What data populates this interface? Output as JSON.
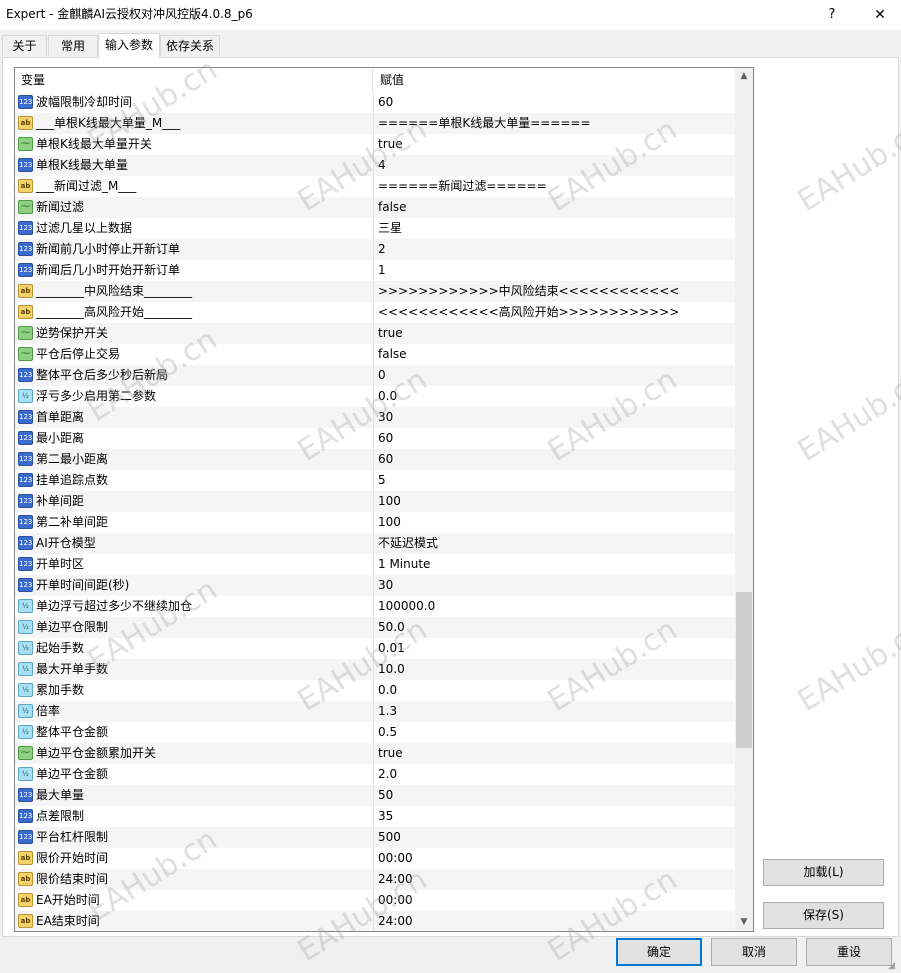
{
  "window": {
    "title": "Expert - 金麒麟AI云授权对冲风控版4.0.8_p6",
    "help_label": "?",
    "close_label": "✕"
  },
  "tabs": [
    {
      "label": "关于",
      "active": false
    },
    {
      "label": "常用",
      "active": false
    },
    {
      "label": "输入参数",
      "active": true
    },
    {
      "label": "依存关系",
      "active": false
    }
  ],
  "grid": {
    "header": {
      "name": "变量",
      "value": "赋值"
    },
    "rows": [
      {
        "type": "int",
        "name": "波幅限制冷却时间",
        "value": "60"
      },
      {
        "type": "str",
        "name": "___单根K线最大单量_M___",
        "value": "======单根K线最大单量======"
      },
      {
        "type": "bool",
        "name": "单根K线最大单量开关",
        "value": "true"
      },
      {
        "type": "int",
        "name": "单根K线最大单量",
        "value": "4"
      },
      {
        "type": "str",
        "name": "___新闻过滤_M___",
        "value": "======新闻过滤======"
      },
      {
        "type": "bool",
        "name": "新闻过滤",
        "value": "false"
      },
      {
        "type": "int",
        "name": "过滤几星以上数据",
        "value": "三星"
      },
      {
        "type": "int",
        "name": "新闻前几小时停止开新订单",
        "value": "2"
      },
      {
        "type": "int",
        "name": "新闻后几小时开始开新订单",
        "value": "1"
      },
      {
        "type": "str",
        "name": "________中风险结束________",
        "value": ">>>>>>>>>>>>中风险结束<<<<<<<<<<<<"
      },
      {
        "type": "str",
        "name": "________高风险开始________",
        "value": "<<<<<<<<<<<<高风险开始>>>>>>>>>>>>"
      },
      {
        "type": "bool",
        "name": "逆势保护开关",
        "value": "true"
      },
      {
        "type": "bool",
        "name": "平仓后停止交易",
        "value": "false"
      },
      {
        "type": "int",
        "name": "整体平仓后多少秒后新局",
        "value": "0"
      },
      {
        "type": "dbl",
        "name": "浮亏多少启用第二参数",
        "value": "0.0"
      },
      {
        "type": "int",
        "name": "首单距离",
        "value": "30"
      },
      {
        "type": "int",
        "name": "最小距离",
        "value": "60"
      },
      {
        "type": "int",
        "name": "第二最小距离",
        "value": "60"
      },
      {
        "type": "int",
        "name": "挂单追踪点数",
        "value": "5"
      },
      {
        "type": "int",
        "name": "补单间距",
        "value": "100"
      },
      {
        "type": "int",
        "name": "第二补单间距",
        "value": "100"
      },
      {
        "type": "int",
        "name": "AI开仓模型",
        "value": "不延迟模式"
      },
      {
        "type": "int",
        "name": "开单时区",
        "value": "1 Minute"
      },
      {
        "type": "int",
        "name": "开单时间间距(秒)",
        "value": "30"
      },
      {
        "type": "dbl",
        "name": "单边浮亏超过多少不继续加仓",
        "value": "100000.0"
      },
      {
        "type": "dbl",
        "name": "单边平仓限制",
        "value": "50.0"
      },
      {
        "type": "dbl",
        "name": "起始手数",
        "value": "0.01"
      },
      {
        "type": "dbl",
        "name": "最大开单手数",
        "value": "10.0"
      },
      {
        "type": "dbl",
        "name": "累加手数",
        "value": "0.0"
      },
      {
        "type": "dbl",
        "name": "倍率",
        "value": "1.3"
      },
      {
        "type": "dbl",
        "name": "整体平仓金额",
        "value": "0.5"
      },
      {
        "type": "bool",
        "name": "单边平仓金额累加开关",
        "value": "true"
      },
      {
        "type": "dbl",
        "name": "单边平仓金额",
        "value": "2.0"
      },
      {
        "type": "int",
        "name": "最大单量",
        "value": "50"
      },
      {
        "type": "int",
        "name": "点差限制",
        "value": "35"
      },
      {
        "type": "int",
        "name": "平台杠杆限制",
        "value": "500"
      },
      {
        "type": "str",
        "name": "限价开始时间",
        "value": "00:00"
      },
      {
        "type": "str",
        "name": "限价结束时间",
        "value": "24:00"
      },
      {
        "type": "str",
        "name": "EA开始时间",
        "value": "00:00"
      },
      {
        "type": "str",
        "name": "EA结束时间",
        "value": "24:00"
      }
    ]
  },
  "type_icons": {
    "int": "123",
    "str": "ab",
    "bool": "⁓",
    "dbl": "½"
  },
  "buttons": {
    "load": "加载(L)",
    "save": "保存(S)",
    "ok": "确定",
    "cancel": "取消",
    "reset": "重设"
  },
  "scrollbar": {
    "up": "▲",
    "down": "▼"
  },
  "watermark": "EAHub.cn"
}
